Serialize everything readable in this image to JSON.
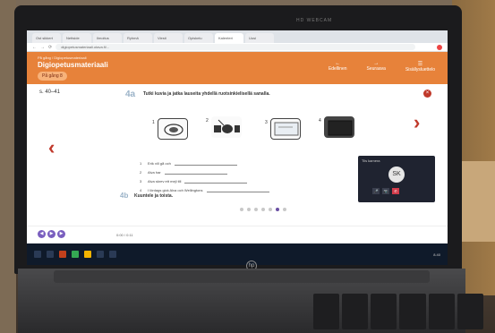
{
  "browser": {
    "tabs": [
      {
        "label": "Ost sikkert"
      },
      {
        "label": "Nettside"
      },
      {
        "label": "Ilmoitus"
      },
      {
        "label": "Ryhmä"
      },
      {
        "label": "Viesti"
      },
      {
        "label": "Opiskelu"
      },
      {
        "label": "Kalenteri"
      },
      {
        "label": "Uusi"
      }
    ],
    "url": "digiopetusmateriaali.otava.fi/...",
    "nav_back": "←",
    "nav_forward": "→",
    "nav_reload": "⟳"
  },
  "app": {
    "breadcrumb": "På gång / Digiopetusmateriaali",
    "title": "Digiopetusmateriaali",
    "section_pill": "På gång 8",
    "nav": [
      {
        "icon": "←",
        "label": "Edellinen"
      },
      {
        "icon": "→",
        "label": "Seuraava"
      },
      {
        "icon": "☰",
        "label": "Sisällysluettelo"
      }
    ],
    "close_glyph": "×"
  },
  "exercise": {
    "page_ref": "s. 40–41",
    "number_a": "4a",
    "instruction": "Tutki kuvia ja jatka lauseita yhdellä ruotsinkielisellä sanalla.",
    "picture_numbers": [
      "1",
      "2",
      "3",
      "4"
    ],
    "sentences": [
      {
        "n": "1",
        "text": "Erik vill gå och"
      },
      {
        "n": "2",
        "text": "Alva har"
      },
      {
        "n": "3",
        "text": "Alva skrev ett mejl till"
      },
      {
        "n": "4",
        "text": "I lördags gick Alva och Wellingtons"
      }
    ],
    "number_b": "4b",
    "instruction_b": "Kuuntele ja toista."
  },
  "player": {
    "time": "0:00 / 0:11",
    "buttons": [
      "◀",
      "▶",
      "▶"
    ]
  },
  "video_call": {
    "label": "Tiis kamera",
    "avatar": "SK",
    "controls": [
      "🎤",
      "📷",
      "✆"
    ]
  },
  "taskbar": {
    "clock": "8.40"
  },
  "laptop": {
    "brand_label": "hp",
    "camera_text": "HD WEBCAM"
  }
}
